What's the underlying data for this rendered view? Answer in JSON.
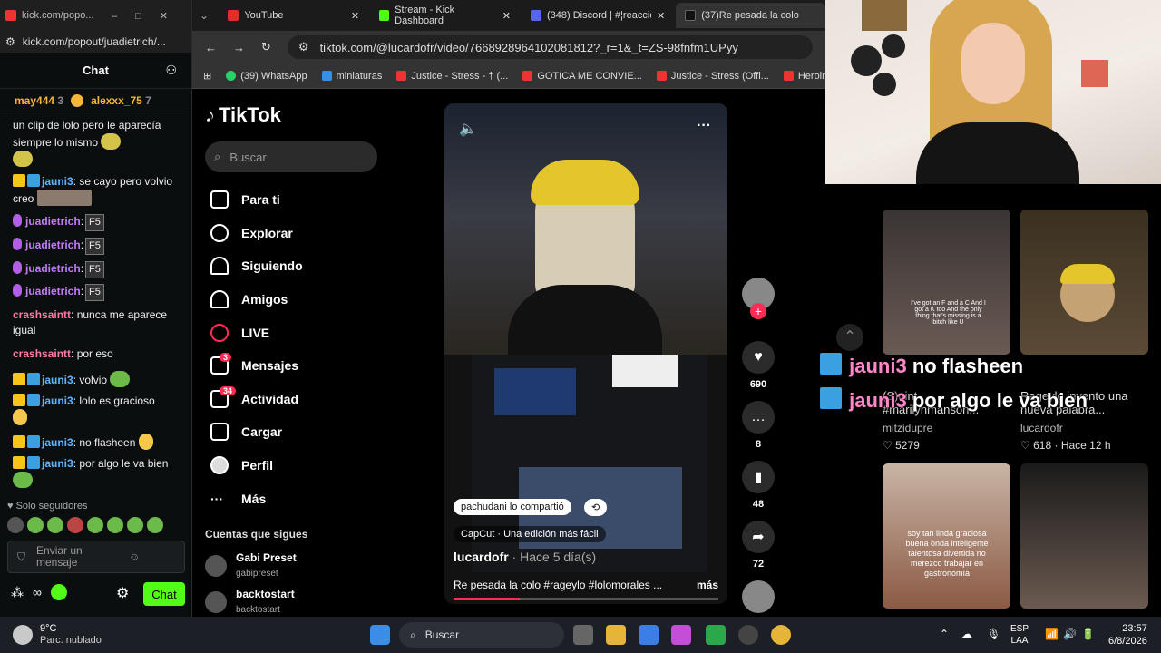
{
  "kick": {
    "tab_title": "kick.com/popo...",
    "url": "kick.com/popout/juadietrich/...",
    "chat_title": "Chat",
    "pinned": [
      {
        "user": "may444",
        "count": "3"
      },
      {
        "user": "alexxx_75",
        "count": "7"
      }
    ],
    "messages": [
      {
        "user": "",
        "text": "un clip de lolo pero le aparecía siempre lo mismo"
      },
      {
        "user": "jauni3",
        "text": ": se cayo pero volvio creo"
      },
      {
        "user": "juadietrich",
        "text": ":",
        "emote": "F5"
      },
      {
        "user": "juadietrich",
        "text": ":",
        "emote": "F5"
      },
      {
        "user": "juadietrich",
        "text": ":",
        "emote": "F5"
      },
      {
        "user": "juadietrich",
        "text": ":",
        "emote": "F5"
      },
      {
        "user": "crashsaintt",
        "text": ": nunca me aparece igual"
      },
      {
        "user": "crashsaintt",
        "text": ": por eso"
      },
      {
        "user": "jauni3",
        "text": ": volvio"
      },
      {
        "user": "jauni3",
        "text": ": lolo es gracioso"
      },
      {
        "user": "jauni3",
        "text": ": no flasheen"
      },
      {
        "user": "jauni3",
        "text": ": por algo le va bien"
      }
    ],
    "followers_only": "Solo seguidores",
    "input_placeholder": "Enviar un mensaje",
    "send_label": "Chat"
  },
  "browser": {
    "tabs": [
      {
        "title": "YouTube",
        "color": "#e52d27"
      },
      {
        "title": "Stream - Kick Dashboard",
        "color": "#53fc18"
      },
      {
        "title": "(348) Discord | #¦reaccion",
        "color": "#5865f2"
      },
      {
        "title": "(37)Re pesada la colo",
        "color": "#111111"
      }
    ],
    "url": "tiktok.com/@lucardofr/video/7668928964102081812?_r=1&_t=ZS-98fnfm1UPyy",
    "bookmarks": [
      "(39) WhatsApp",
      "miniaturas",
      "Justice - Stress - † (...",
      "GOTICA ME CONVIE...",
      "Justice - Stress (Offi...",
      "Heroin Makes H"
    ]
  },
  "tiktok": {
    "logo": "TikTok",
    "search_placeholder": "Buscar",
    "nav": [
      {
        "label": "Para ti",
        "badge": ""
      },
      {
        "label": "Explorar",
        "badge": ""
      },
      {
        "label": "Siguiendo",
        "badge": ""
      },
      {
        "label": "Amigos",
        "badge": ""
      },
      {
        "label": "LIVE",
        "badge": ""
      },
      {
        "label": "Mensajes",
        "badge": "3"
      },
      {
        "label": "Actividad",
        "badge": "34"
      },
      {
        "label": "Cargar",
        "badge": ""
      },
      {
        "label": "Perfil",
        "badge": ""
      },
      {
        "label": "Más",
        "badge": ""
      }
    ],
    "following_title": "Cuentas que sigues",
    "following": [
      {
        "name": "Gabi Preset",
        "handle": "gabipreset"
      },
      {
        "name": "backtostart",
        "handle": "backtostart"
      }
    ],
    "video": {
      "shared_by": "pachudani lo compartió",
      "capcut": "CapCut · Una edición más fácil",
      "author": "lucardofr",
      "time": "· Hace 5 día(s)",
      "description": "Re pesada la colo #rageylo #lolomorales ...",
      "more": "más",
      "progress": 0.25
    },
    "actions": {
      "likes": "690",
      "comments": "8",
      "saves": "48",
      "shares": "72"
    }
  },
  "right": {
    "cards": [
      {
        "caption": "(S)uint #marilynmanson...",
        "author": "mitzidupre",
        "likes": "5279",
        "time": ""
      },
      {
        "caption": "Rageylo invento una nueva palabra...",
        "author": "lucardofr",
        "likes": "618",
        "time": "· Hace 12 h"
      }
    ],
    "thumb_text_1": "I've got an F and a C And I got a K too And the only thing that's missing is a bitch like U",
    "thumb_text_3": "soy tan linda graciosa buena onda inteligente talentosa divertida no merezco trabajar en gastronomía",
    "overlay": [
      {
        "user": "jauni3",
        "text": "no flasheen"
      },
      {
        "user": "jauni3",
        "text": "por algo le va bien"
      }
    ]
  },
  "taskbar": {
    "weather_temp": "9°C",
    "weather_desc": "Parc. nublado",
    "search": "Buscar",
    "lang": "ESP",
    "lang2": "LAA",
    "time": "23:57",
    "date": "6/8/2026"
  }
}
